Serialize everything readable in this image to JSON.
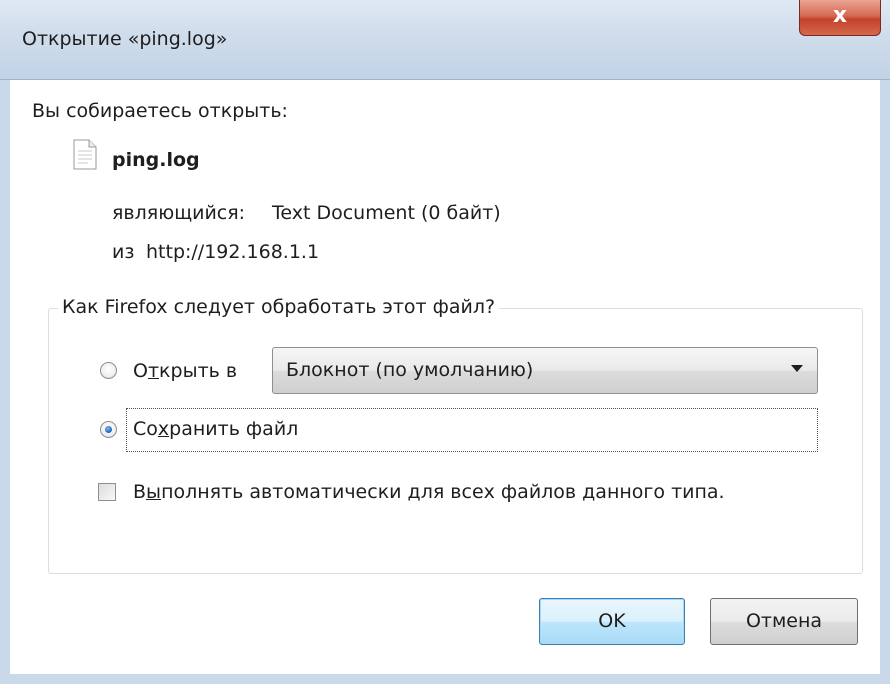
{
  "window": {
    "title": "Открытие «ping.log»",
    "close_symbol": "x"
  },
  "info": {
    "intro": "Вы собираетесь открыть:",
    "file_icon": "text-file-icon",
    "file_name": "ping.log",
    "type_label": "являющийся:",
    "type_value": "Text Document (0 байт)",
    "from_label": "из",
    "from_value": "http://192.168.1.1"
  },
  "action_group": {
    "title": "Как Firefox следует обработать этот файл?",
    "open_with": {
      "label_before": "О",
      "label_underlined": "т",
      "label_after": "крыть в",
      "selected": false,
      "app": "Блокнот (по умолчанию)"
    },
    "save_file": {
      "label_before": "Со",
      "label_underlined": "х",
      "label_after": "ранить файл",
      "selected": true
    },
    "auto": {
      "label_before": "В",
      "label_underlined": "ы",
      "label_after": "полнять автоматически для всех файлов данного типа.",
      "checked": false
    }
  },
  "buttons": {
    "ok": "OK",
    "cancel": "Отмена"
  }
}
